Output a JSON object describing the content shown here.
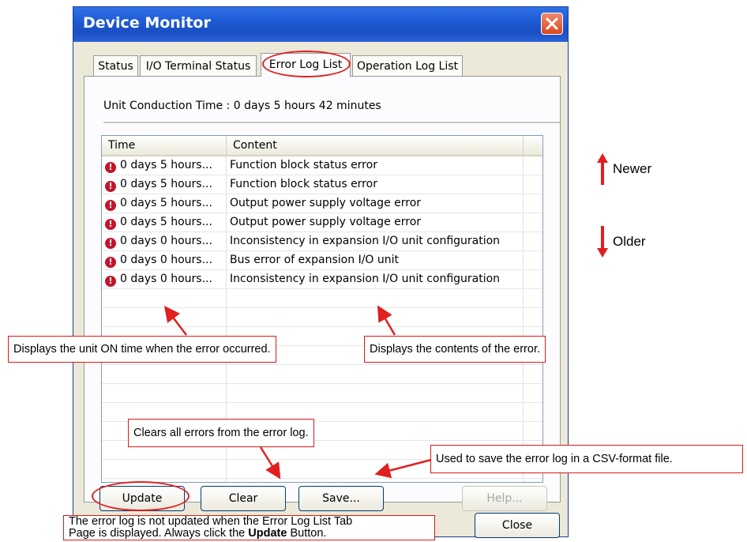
{
  "window": {
    "title": "Device Monitor",
    "close_icon": "close-icon"
  },
  "tabs": [
    {
      "label": "Status"
    },
    {
      "label": "I/O Terminal Status"
    },
    {
      "label": "Error Log List",
      "active": true
    },
    {
      "label": "Operation Log List"
    }
  ],
  "conduction_time": "Unit Conduction Time : 0 days 5 hours 42 minutes",
  "table": {
    "columns": [
      "Time",
      "Content"
    ],
    "rows": [
      {
        "time": "0 days 5 hours...",
        "content": "Function block status error"
      },
      {
        "time": "0 days 5 hours...",
        "content": "Function block status error"
      },
      {
        "time": "0 days 5 hours...",
        "content": "Output power supply voltage error"
      },
      {
        "time": "0 days 5 hours...",
        "content": "Output power supply voltage error"
      },
      {
        "time": "0 days 0 hours...",
        "content": "Inconsistency in expansion I/O unit configuration"
      },
      {
        "time": "0 days 0 hours...",
        "content": "Bus error of expansion I/O unit"
      },
      {
        "time": "0 days 0 hours...",
        "content": "Inconsistency in expansion I/O unit configuration"
      }
    ],
    "row_icon": "error-icon"
  },
  "buttons": {
    "update": "Update",
    "clear": "Clear",
    "save": "Save...",
    "help": "Help...",
    "close": "Close"
  },
  "annotations": {
    "time_note": "Displays the unit ON time when the error occurred.",
    "content_note": "Displays the contents of the error.",
    "clear_note": "Clears all errors from the error log.",
    "save_note": "Used to save the error log in a CSV-format file.",
    "update_note_line1": "The error log is not updated when the Error Log List Tab",
    "update_note_line2_prefix": "Page is displayed. Always click the ",
    "update_note_bold": "Update",
    "update_note_line2_suffix": " Button.",
    "newer": "Newer",
    "older": "Older"
  },
  "colors": {
    "annotation_red": "#e02020",
    "error_icon": "#c4152b",
    "titlebar": "#1e5bd6"
  }
}
